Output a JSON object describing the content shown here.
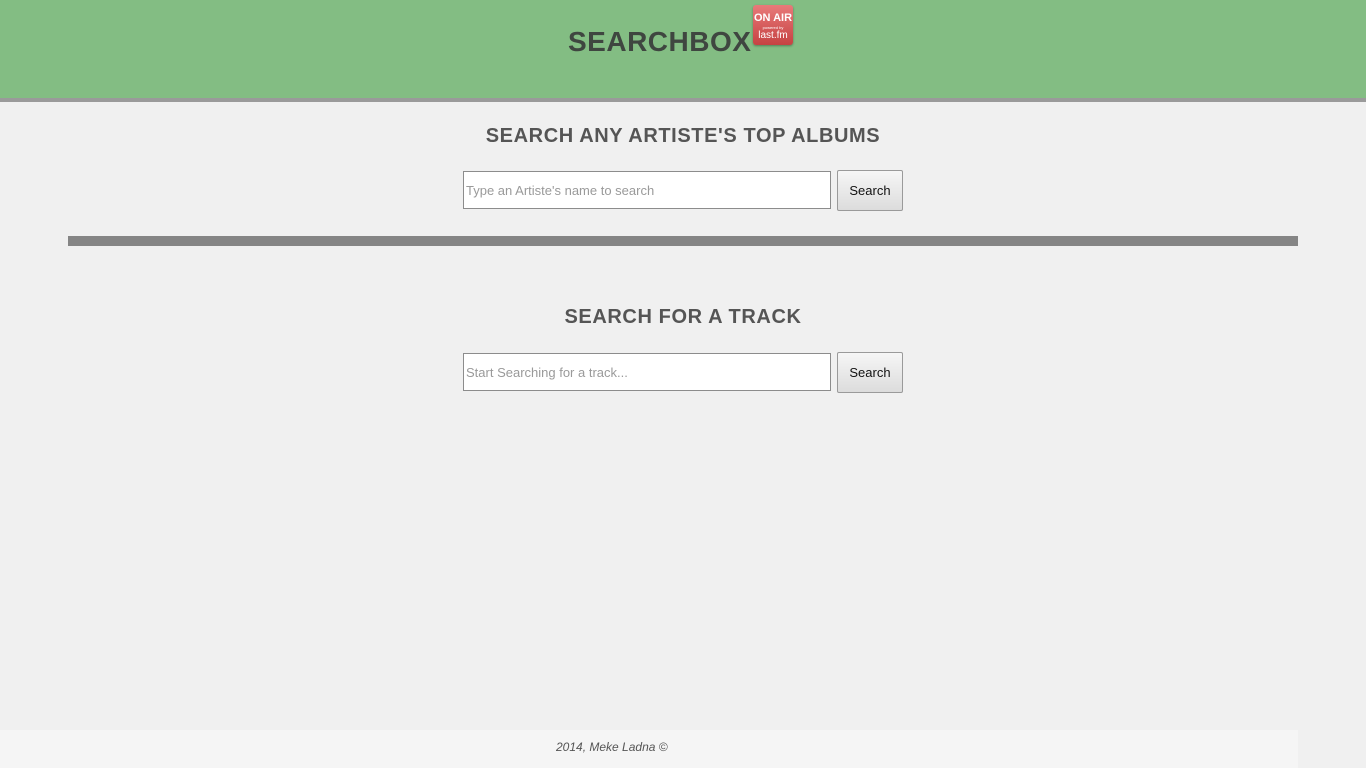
{
  "header": {
    "brand": "SEARCHBOX",
    "badge": {
      "line1": "ON AIR",
      "line2": "powered by",
      "line3": "last.fm"
    },
    "background_color": "#83bd83"
  },
  "album_search": {
    "title": "SEARCH ANY ARTISTE'S TOP ALBUMS",
    "placeholder": "Type an Artiste's name to search",
    "value": "",
    "button_label": "Search"
  },
  "track_search": {
    "title": "SEARCH FOR A TRACK",
    "placeholder": "Start Searching for a track...",
    "value": "",
    "button_label": "Search"
  },
  "footer": {
    "text": "2014, Meke Ladna ©"
  }
}
